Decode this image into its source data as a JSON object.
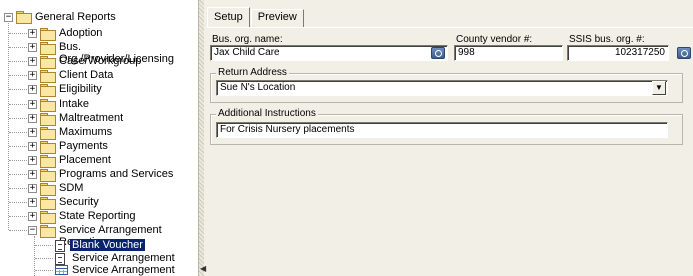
{
  "tree": {
    "root": "General Reports",
    "items": [
      {
        "label": "Adoption"
      },
      {
        "label": "Bus. Org./Provider/Licensing"
      },
      {
        "label": "Case/Workgroup"
      },
      {
        "label": "Client Data"
      },
      {
        "label": "Eligibility"
      },
      {
        "label": "Intake"
      },
      {
        "label": "Maltreatment"
      },
      {
        "label": "Maximums"
      },
      {
        "label": "Payments"
      },
      {
        "label": "Placement"
      },
      {
        "label": "Programs and Services"
      },
      {
        "label": "SDM"
      },
      {
        "label": "Security"
      },
      {
        "label": "State Reporting"
      },
      {
        "label": "Service Arrangement Reporting"
      }
    ],
    "children": [
      {
        "label": "Blank Voucher",
        "selected": true,
        "icon": "document-icon"
      },
      {
        "label": "Service Arrangement",
        "icon": "document-icon"
      },
      {
        "label": "Service Arrangement Detail",
        "icon": "grid-report-icon"
      }
    ],
    "expand_symbol": "+",
    "collapse_symbol": "−",
    "selection_color": "#0a246a"
  },
  "tabs": [
    {
      "label": "Setup",
      "active": true
    },
    {
      "label": "Preview",
      "active": false
    }
  ],
  "form": {
    "bus_org_name": {
      "label": "Bus. org. name:",
      "value": "Jax Child Care"
    },
    "county_vendor": {
      "label": "County vendor #:",
      "value": "998"
    },
    "ssis_bus_org": {
      "label": "SSIS bus. org. #:",
      "value": "102317250"
    },
    "return_address": {
      "title": "Return Address",
      "value": "Sue N's Location",
      "dropdown_glyph": "▼"
    },
    "additional_instructions": {
      "title": "Additional Instructions",
      "value": "For Crisis Nursery placements"
    }
  },
  "splitter_glyph": "◀"
}
